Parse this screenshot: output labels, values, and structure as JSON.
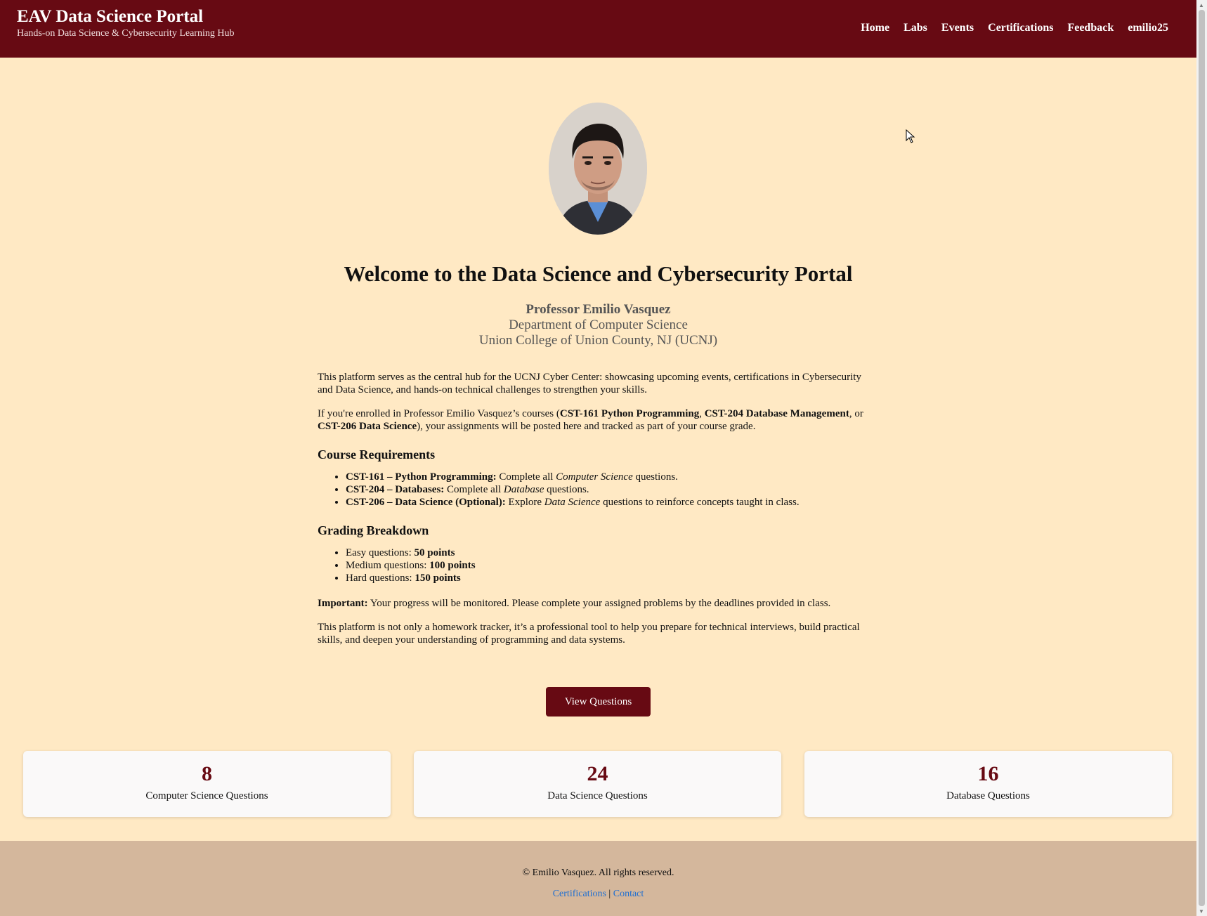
{
  "header": {
    "title": "EAV Data Science Portal",
    "subtitle": "Hands-on Data Science & Cybersecurity Learning Hub",
    "nav": [
      "Home",
      "Labs",
      "Events",
      "Certifications",
      "Feedback",
      "emilio25"
    ]
  },
  "hero": {
    "title": "Welcome to the Data Science and Cybersecurity Portal",
    "professor": "Professor Emilio Vasquez",
    "department": "Department of Computer Science",
    "college": "Union College of Union County, NJ (UCNJ)"
  },
  "intro": {
    "p1": "This platform serves as the central hub for the UCNJ Cyber Center: showcasing upcoming events, certifications in Cybersecurity and Data Science, and hands-on technical challenges to strengthen your skills.",
    "p2_a": "If you're enrolled in Professor Emilio Vasquez’s courses (",
    "p2_c1": "CST-161 Python Programming",
    "p2_sep1": ", ",
    "p2_c2": "CST-204 Database Management",
    "p2_sep2": ", or ",
    "p2_c3": "CST-206 Data Science",
    "p2_b": "), your assignments will be posted here and tracked as part of your course grade."
  },
  "requirements": {
    "heading": "Course Requirements",
    "items": [
      {
        "course": "CST-161 – Python Programming:",
        "pre": " Complete all ",
        "em": "Computer Science",
        "post": " questions."
      },
      {
        "course": "CST-204 – Databases:",
        "pre": " Complete all ",
        "em": "Database",
        "post": " questions."
      },
      {
        "course": "CST-206 – Data Science (Optional):",
        "pre": " Explore ",
        "em": "Data Science",
        "post": " questions to reinforce concepts taught in class."
      }
    ]
  },
  "grading": {
    "heading": "Grading Breakdown",
    "items": [
      {
        "label": "Easy questions: ",
        "points": "50 points"
      },
      {
        "label": "Medium questions: ",
        "points": "100 points"
      },
      {
        "label": "Hard questions: ",
        "points": "150 points"
      }
    ]
  },
  "important": {
    "label": "Important:",
    "text": " Your progress will be monitored. Please complete your assigned problems by the deadlines provided in class."
  },
  "closing": "This platform is not only a homework tracker, it’s a professional tool to help you prepare for technical interviews, build practical skills, and deepen your understanding of programming and data systems.",
  "cta": "View Questions",
  "stats": [
    {
      "value": "8",
      "label": "Computer Science Questions"
    },
    {
      "value": "24",
      "label": "Data Science Questions"
    },
    {
      "value": "16",
      "label": "Database Questions"
    }
  ],
  "footer": {
    "copyright": "© Emilio Vasquez. All rights reserved.",
    "link1": "Certifications",
    "sep": " | ",
    "link2": "Contact"
  },
  "colors": {
    "brand": "#670a13",
    "background": "#ffe9c4",
    "footer": "#d4b79c",
    "link": "#1f6fd1"
  }
}
